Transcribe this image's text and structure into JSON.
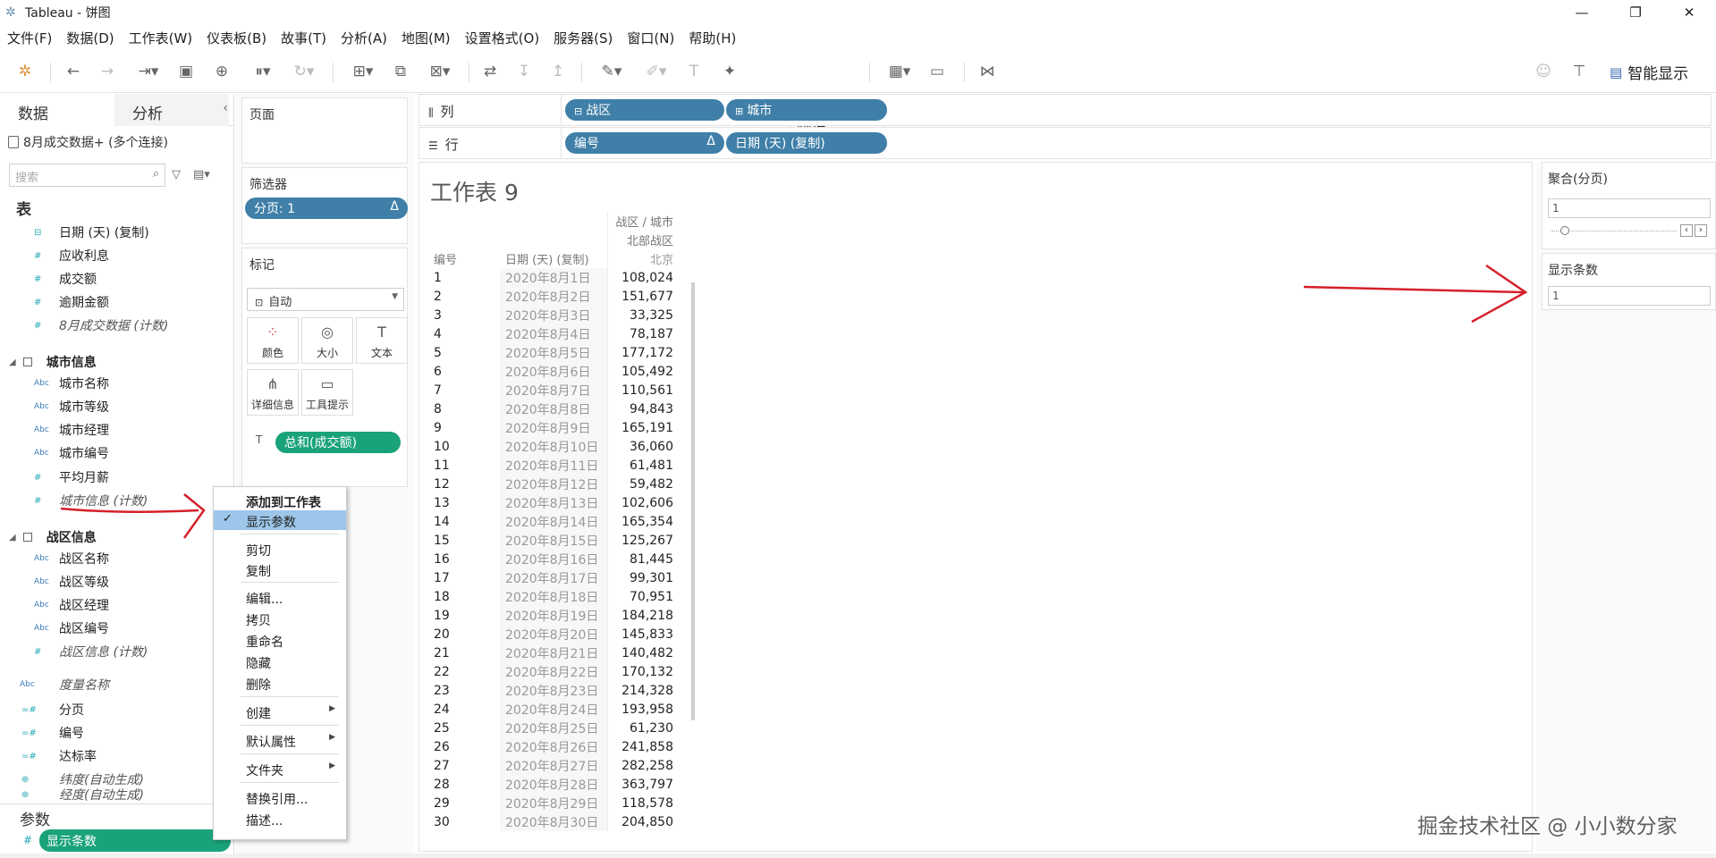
{
  "window": {
    "title": "Tableau - 饼图"
  },
  "menu": [
    "文件(F)",
    "数据(D)",
    "工作表(W)",
    "仪表板(B)",
    "故事(T)",
    "分析(A)",
    "地图(M)",
    "设置格式(O)",
    "服务器(S)",
    "窗口(N)",
    "帮助(H)"
  ],
  "toolbar": {
    "fit_select": "标准",
    "smart_show": "智能显示"
  },
  "left": {
    "tab_data": "数据",
    "tab_analysis": "分析",
    "connection": "8月成交数据+ (多个连接)",
    "search_placeholder": "搜索",
    "tables_header": "表",
    "fields_top": [
      "日期 (天) (复制)",
      "应收利息",
      "成交额",
      "逾期金额",
      "8月成交数据 (计数)"
    ],
    "group1": {
      "name": "城市信息",
      "fields": [
        "城市名称",
        "城市等级",
        "城市经理",
        "城市编号"
      ]
    },
    "group1_extra": [
      "平均月薪",
      "城市信息 (计数)"
    ],
    "group2": {
      "name": "战区信息",
      "fields": [
        "战区名称",
        "战区等级",
        "战区经理",
        "战区编号"
      ]
    },
    "group2_extra": "战区信息 (计数)",
    "measure_names": "度量名称",
    "fields_bottom": [
      "分页",
      "编号",
      "达标率",
      "纬度(自动生成)",
      "经度(自动生成)"
    ],
    "params_header": "参数",
    "param_pill": "显示条数"
  },
  "shelves": {
    "pages_label": "页面",
    "filters_label": "筛选器",
    "filter_pill": "分页: 1",
    "marks_label": "标记",
    "mark_type": "自动",
    "mark_buttons": [
      "颜色",
      "大小",
      "文本",
      "详细信息",
      "工具提示"
    ],
    "mark_pill": "总和(成交额)",
    "columns_label": "列",
    "columns_pills": [
      "战区",
      "城市"
    ],
    "rows_label": "行",
    "rows_pills": [
      "编号",
      "日期 (天) (复制)"
    ]
  },
  "sheet": {
    "title": "工作表 9",
    "header_top": "战区 / 城市",
    "header_region": "北部战区",
    "col_no": "编号",
    "col_date": "日期 (天) (复制)",
    "col_city": "北京",
    "rows": [
      [
        "1",
        "2020年8月1日",
        "108,024"
      ],
      [
        "2",
        "2020年8月2日",
        "151,677"
      ],
      [
        "3",
        "2020年8月3日",
        "33,325"
      ],
      [
        "4",
        "2020年8月4日",
        "78,187"
      ],
      [
        "5",
        "2020年8月5日",
        "177,172"
      ],
      [
        "6",
        "2020年8月6日",
        "105,492"
      ],
      [
        "7",
        "2020年8月7日",
        "110,561"
      ],
      [
        "8",
        "2020年8月8日",
        "94,843"
      ],
      [
        "9",
        "2020年8月9日",
        "165,191"
      ],
      [
        "10",
        "2020年8月10日",
        "36,060"
      ],
      [
        "11",
        "2020年8月11日",
        "61,481"
      ],
      [
        "12",
        "2020年8月12日",
        "59,482"
      ],
      [
        "13",
        "2020年8月13日",
        "102,606"
      ],
      [
        "14",
        "2020年8月14日",
        "165,354"
      ],
      [
        "15",
        "2020年8月15日",
        "125,267"
      ],
      [
        "16",
        "2020年8月16日",
        "81,445"
      ],
      [
        "17",
        "2020年8月17日",
        "99,301"
      ],
      [
        "18",
        "2020年8月18日",
        "70,951"
      ],
      [
        "19",
        "2020年8月19日",
        "184,218"
      ],
      [
        "20",
        "2020年8月20日",
        "145,833"
      ],
      [
        "21",
        "2020年8月21日",
        "140,482"
      ],
      [
        "22",
        "2020年8月22日",
        "170,132"
      ],
      [
        "23",
        "2020年8月23日",
        "214,328"
      ],
      [
        "24",
        "2020年8月24日",
        "193,958"
      ],
      [
        "25",
        "2020年8月25日",
        "61,230"
      ],
      [
        "26",
        "2020年8月26日",
        "241,858"
      ],
      [
        "27",
        "2020年8月27日",
        "282,258"
      ],
      [
        "28",
        "2020年8月28日",
        "363,797"
      ],
      [
        "29",
        "2020年8月29日",
        "118,578"
      ],
      [
        "30",
        "2020年8月30日",
        "204,850"
      ]
    ]
  },
  "right": {
    "agg_title": "聚合(分页)",
    "agg_value": "1",
    "show_title": "显示条数",
    "show_value": "1"
  },
  "context_menu": {
    "items": [
      "添加到工作表",
      "显示参数",
      "剪切",
      "复制",
      "编辑...",
      "拷贝",
      "重命名",
      "隐藏",
      "删除",
      "创建",
      "默认属性",
      "文件夹",
      "替换引用...",
      "描述..."
    ]
  },
  "watermark": "掘金技术社区 @ 小小数分家"
}
